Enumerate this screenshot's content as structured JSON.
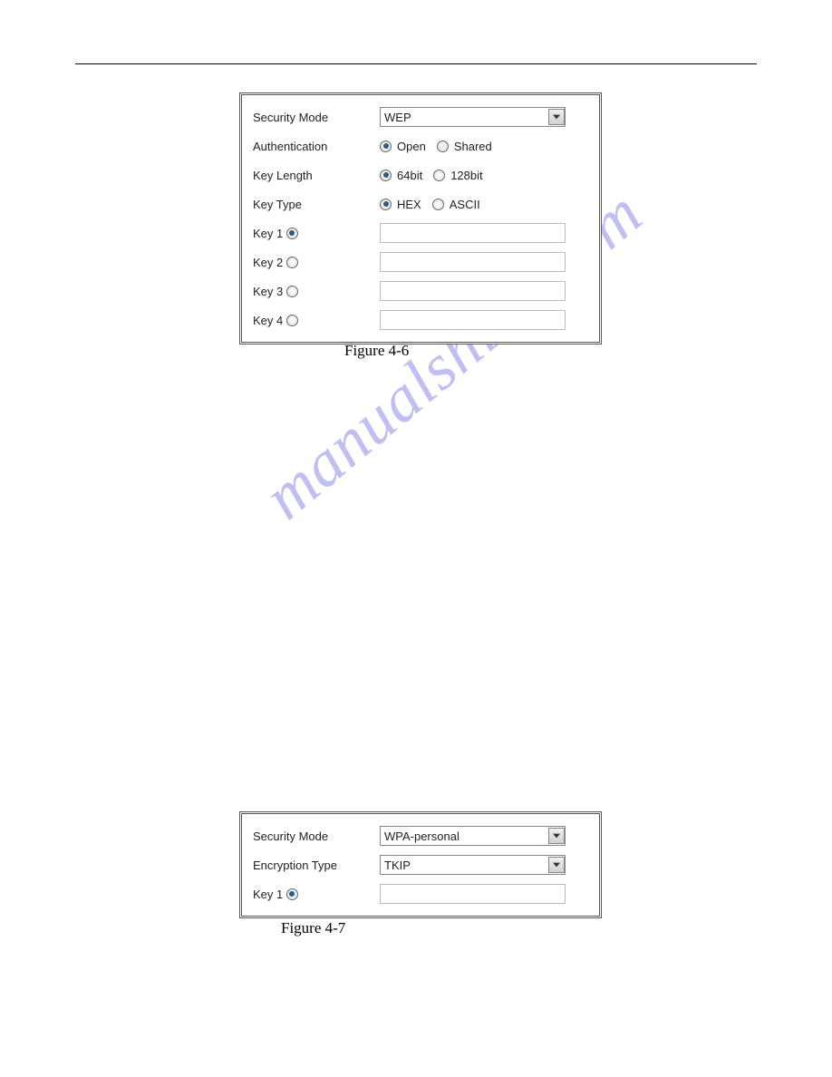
{
  "watermark": "manualshive.com",
  "panel1": {
    "securityModeLabel": "Security Mode",
    "securityModeValue": "WEP",
    "authLabel": "Authentication",
    "authOption1": "Open",
    "authOption2": "Shared",
    "keyLengthLabel": "Key Length",
    "keyLengthOption1": "64bit",
    "keyLengthOption2": "128bit",
    "keyTypeLabel": "Key Type",
    "keyTypeOption1": "HEX",
    "keyTypeOption2": "ASCII",
    "key1Label": "Key 1",
    "key2Label": "Key 2",
    "key3Label": "Key 3",
    "key4Label": "Key 4"
  },
  "caption1": "Figure 4-6",
  "panel2": {
    "securityModeLabel": "Security Mode",
    "securityModeValue": "WPA-personal",
    "encryptionTypeLabel": "Encryption Type",
    "encryptionTypeValue": "TKIP",
    "key1Label": "Key 1"
  },
  "caption2": "Figure 4-7"
}
